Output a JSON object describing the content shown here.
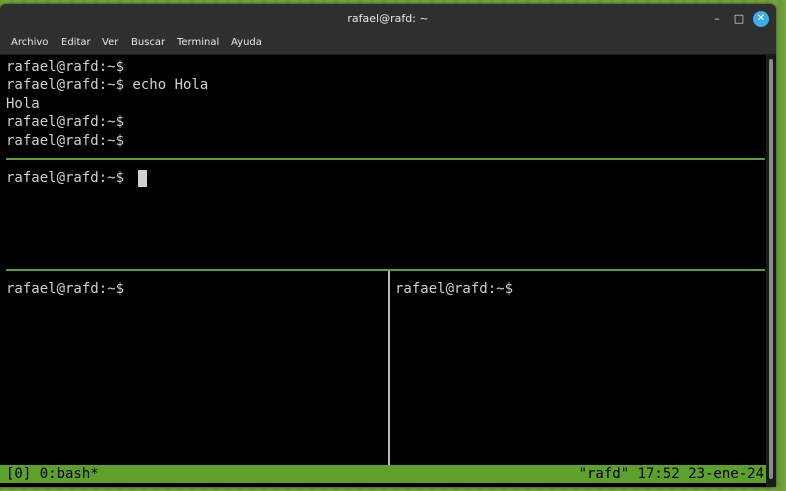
{
  "window": {
    "title": "rafael@rafd: ~",
    "controls": {
      "minimize_icon": "–",
      "maximize_icon": "□",
      "close_icon": "✕"
    }
  },
  "menubar": {
    "items": [
      "Archivo",
      "Editar",
      "Ver",
      "Buscar",
      "Terminal",
      "Ayuda"
    ]
  },
  "panes": {
    "top": {
      "lines": [
        "rafael@rafd:~$",
        "rafael@rafd:~$ echo Hola",
        "Hola",
        "rafael@rafd:~$",
        "rafael@rafd:~$"
      ]
    },
    "middle": {
      "lines": [
        "rafael@rafd:~$"
      ]
    },
    "bottom_left": {
      "lines": [
        "rafael@rafd:~$"
      ]
    },
    "bottom_right": {
      "lines": [
        "rafael@rafd:~$"
      ]
    }
  },
  "statusbar": {
    "left": "[0] 0:bash*",
    "right": "\"rafd\" 17:52 23-ene-24"
  },
  "colors": {
    "accent": "#5ea02c",
    "terminal_bg": "#000000",
    "terminal_fg": "#d0d0d0",
    "titlebar": "#2f2f2f",
    "close_button": "#3daee9"
  }
}
